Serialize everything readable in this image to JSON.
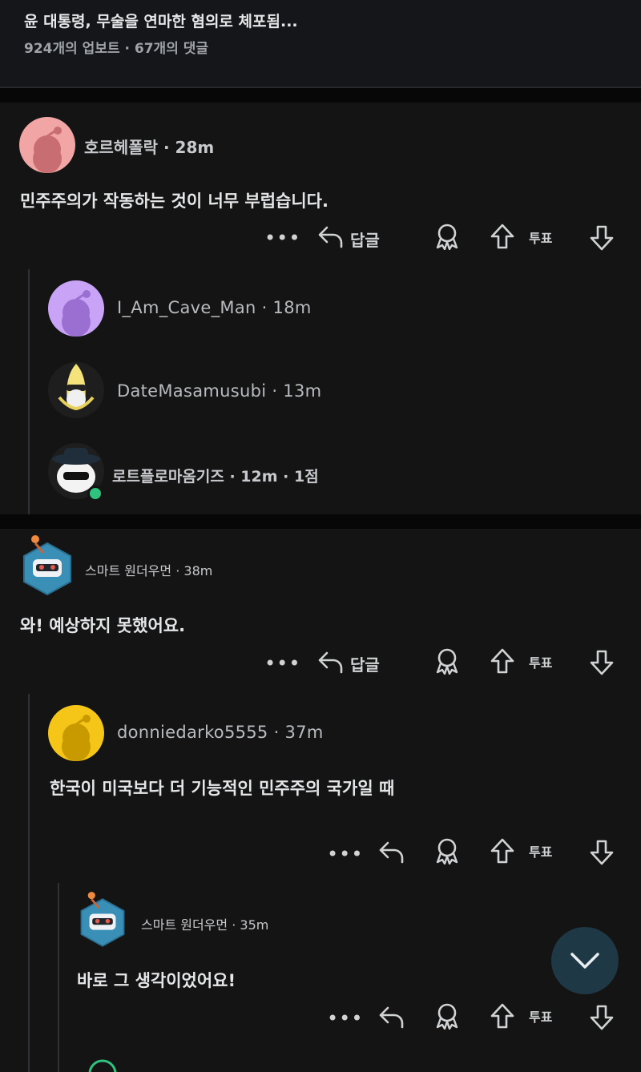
{
  "post": {
    "title": "윤 대통령, 무술을 연마한 혐의로 체포됨...",
    "meta": "924개의 업보트 · 67개의 댓글"
  },
  "actions": {
    "reply_label": "답글",
    "vote_label": "투표",
    "more_label": "•••"
  },
  "comments": [
    {
      "user": "호르헤폴락",
      "time_meta": "· 28m",
      "text": "민주주의가 작동하는 것이 너무 부럽습니다.",
      "avatar_color": "#f2a5a5",
      "collapsed_replies": [
        {
          "user": "I_Am_Cave_Man",
          "meta": "· 18m",
          "avatar_color": "#c9a3f5"
        },
        {
          "user": "DateMasamusubi",
          "meta": "· 13m",
          "avatar_color": "#1e1e1e"
        },
        {
          "user": "로트플로마옴기즈",
          "meta": "· 12m · 1점",
          "avatar_color": "#1e1e1e"
        }
      ]
    },
    {
      "user": "스마트 원더우먼",
      "time_meta": "· 38m",
      "text": "와! 예상하지 못했어요.",
      "avatar_color": "#3a8fb7",
      "replies": [
        {
          "user": "donniedarko5555",
          "time_meta": "· 37m",
          "text": "한국이 미국보다 더 기능적인 민주주의 국가일 때",
          "avatar_color": "#f5c518",
          "replies": [
            {
              "user": "스마트 원더우먼",
              "time_meta": "· 35m",
              "text": "바로 그 생각이었어요!",
              "avatar_color": "#3a8fb7"
            }
          ]
        }
      ]
    }
  ],
  "colors": {
    "background": "#0e0e10",
    "section": "#141414",
    "fab": "#1f3845",
    "online": "#2ec27e"
  },
  "icons": [
    "reply-arrow-icon",
    "award-icon",
    "upvote-icon",
    "downvote-icon",
    "more-icon",
    "chevron-down-icon"
  ]
}
